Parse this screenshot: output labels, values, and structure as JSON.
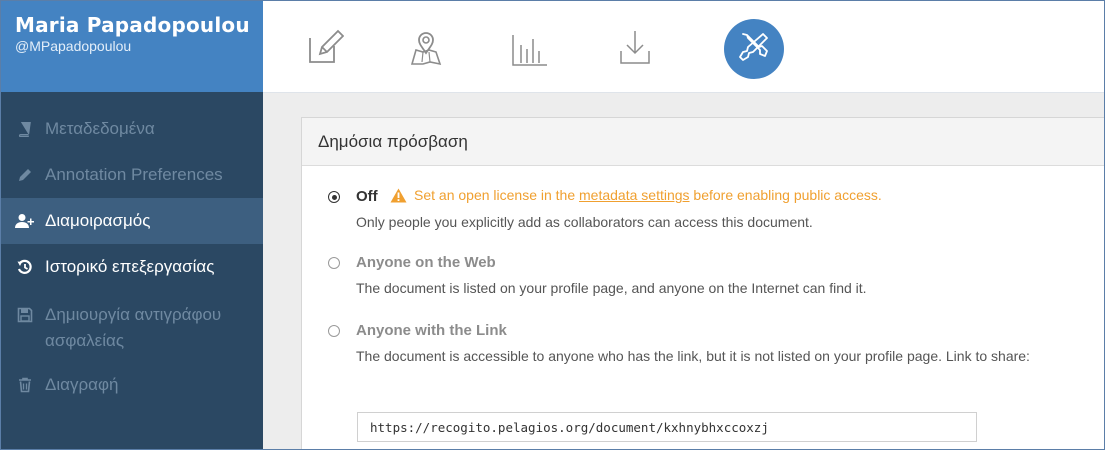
{
  "user": {
    "name": "Maria Papadopoulou",
    "handle": "@MPapadopoulou"
  },
  "sidebar": {
    "items": [
      {
        "label": "Μεταδεδομένα",
        "icon": "book-icon",
        "state": "dim"
      },
      {
        "label": "Annotation Preferences",
        "icon": "pencil-icon",
        "state": "dim"
      },
      {
        "label": "Διαμοιρασμός",
        "icon": "add-user-icon",
        "state": "active"
      },
      {
        "label": "Ιστορικό επεξεργασίας",
        "icon": "history-icon",
        "state": "bright"
      },
      {
        "label": "Δημιουργία αντιγράφου ασφαλείας",
        "icon": "floppy-disk-icon",
        "state": "dim"
      },
      {
        "label": "Διαγραφή",
        "icon": "trash-icon",
        "state": "dim"
      }
    ]
  },
  "toolbar": {
    "tools": [
      {
        "icon": "edit-icon",
        "active": false
      },
      {
        "icon": "map-icon",
        "active": false
      },
      {
        "icon": "bar-chart-icon",
        "active": false
      },
      {
        "icon": "download-icon",
        "active": false
      },
      {
        "icon": "tools-icon",
        "active": true
      }
    ]
  },
  "panel": {
    "title": "Δημόσια πρόσβαση",
    "options": [
      {
        "label": "Off",
        "checked": true,
        "warning_prefix": "Set an open license in the ",
        "warning_link": "metadata settings",
        "warning_suffix": " before enabling public access.",
        "description": "Only people you explicitly add as collaborators can access this document."
      },
      {
        "label": "Anyone on the Web",
        "checked": false,
        "description": "The document is listed on your profile page, and anyone on the Internet can find it."
      },
      {
        "label": "Anyone with the Link",
        "checked": false,
        "description": "The document is accessible to anyone who has the link, but it is not listed on your profile page. Link to share:"
      }
    ],
    "share_link": "https://recogito.pelagios.org/document/kxhnybhxccoxzj"
  },
  "colors": {
    "sidebar_bg": "#2b4863",
    "user_bg": "#4483c2",
    "active_item_bg": "#3d5f80",
    "warning": "#f0a030",
    "accent": "#4483c2"
  }
}
